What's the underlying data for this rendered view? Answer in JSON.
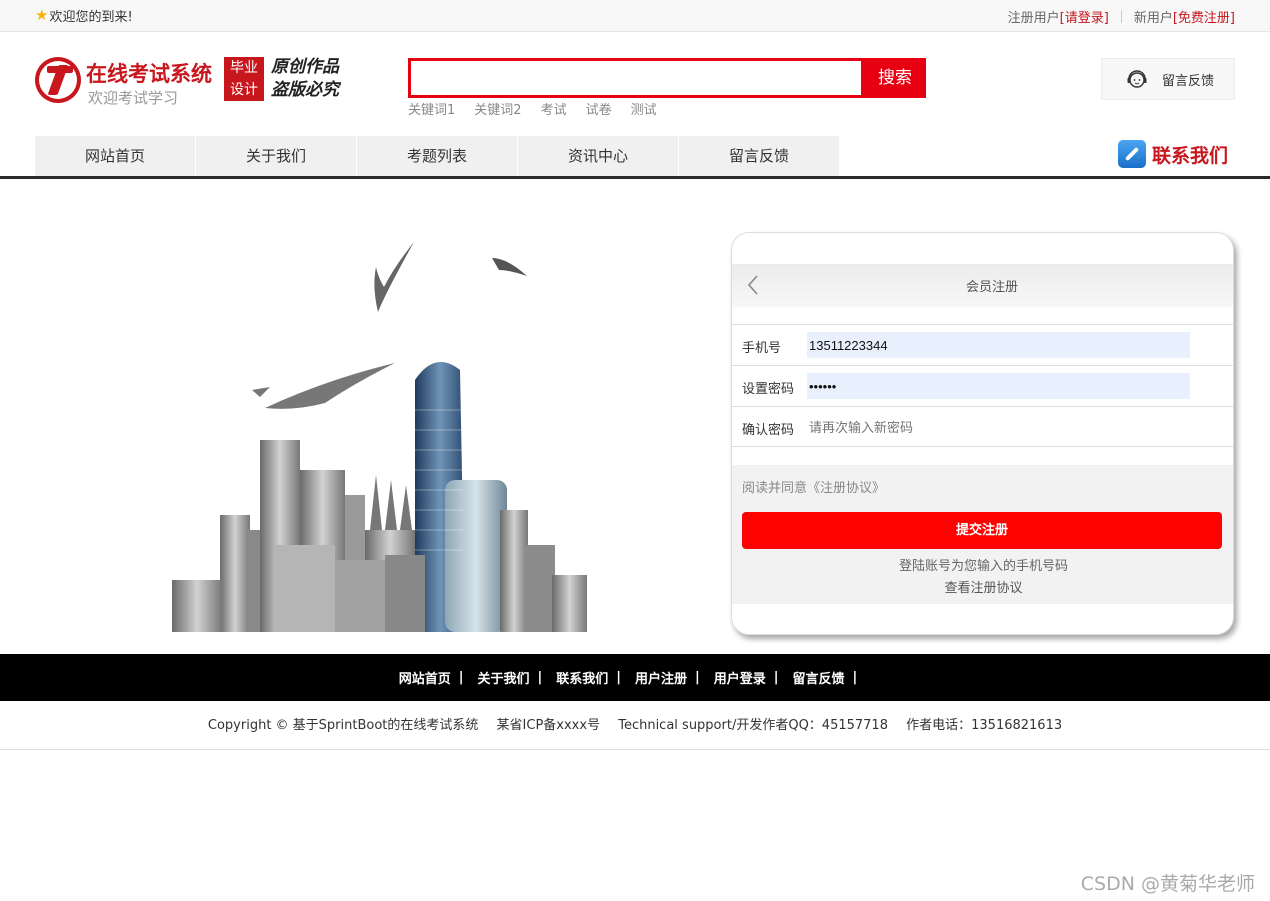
{
  "topbar": {
    "welcome": "欢迎您的到来!",
    "register_user_label": "注册用户",
    "login_link": "[请登录]",
    "new_user_label": "新用户",
    "free_register_link": "[免费注册]"
  },
  "header": {
    "site_title": "在线考试系统",
    "site_subtitle": "欢迎考试学习",
    "badge_line1": "毕业",
    "badge_line2": "设计",
    "slogan_line1": "原创作品",
    "slogan_line2": "盗版必究",
    "search_value": "",
    "search_button": "搜索",
    "keywords": [
      "关键词1",
      "关键词2",
      "考试",
      "试卷",
      "测试"
    ],
    "feedback_button": "留言反馈"
  },
  "nav": {
    "items": [
      "网站首页",
      "关于我们",
      "考题列表",
      "资讯中心",
      "留言反馈"
    ],
    "contact": "联系我们"
  },
  "register": {
    "title": "会员注册",
    "phone_label": "手机号",
    "phone_value": "13511223344",
    "password_label": "设置密码",
    "password_value": "••••••",
    "confirm_label": "确认密码",
    "confirm_placeholder": "请再次输入新密码",
    "agree_text": "阅读并同意《注册协议》",
    "submit_button": "提交注册",
    "note_account": "登陆账号为您输入的手机号码",
    "view_agreement": "查看注册协议"
  },
  "footer": {
    "links": [
      "网站首页",
      "关于我们",
      "联系我们",
      "用户注册",
      "用户登录",
      "留言反馈"
    ],
    "separator": "|",
    "copyright": "Copyright © 基于SprintBoot的在线考试系统",
    "icp": "某省ICP备xxxx号",
    "support": "Technical support/开发作者QQ：45157718",
    "phone": "作者电话：13516821613"
  },
  "watermark": "CSDN @黄菊华老师",
  "colors": {
    "brand_red": "#c8161d",
    "search_red": "#e60012",
    "submit_red": "#fc0200",
    "autofill_blue": "#e8f0fe"
  }
}
